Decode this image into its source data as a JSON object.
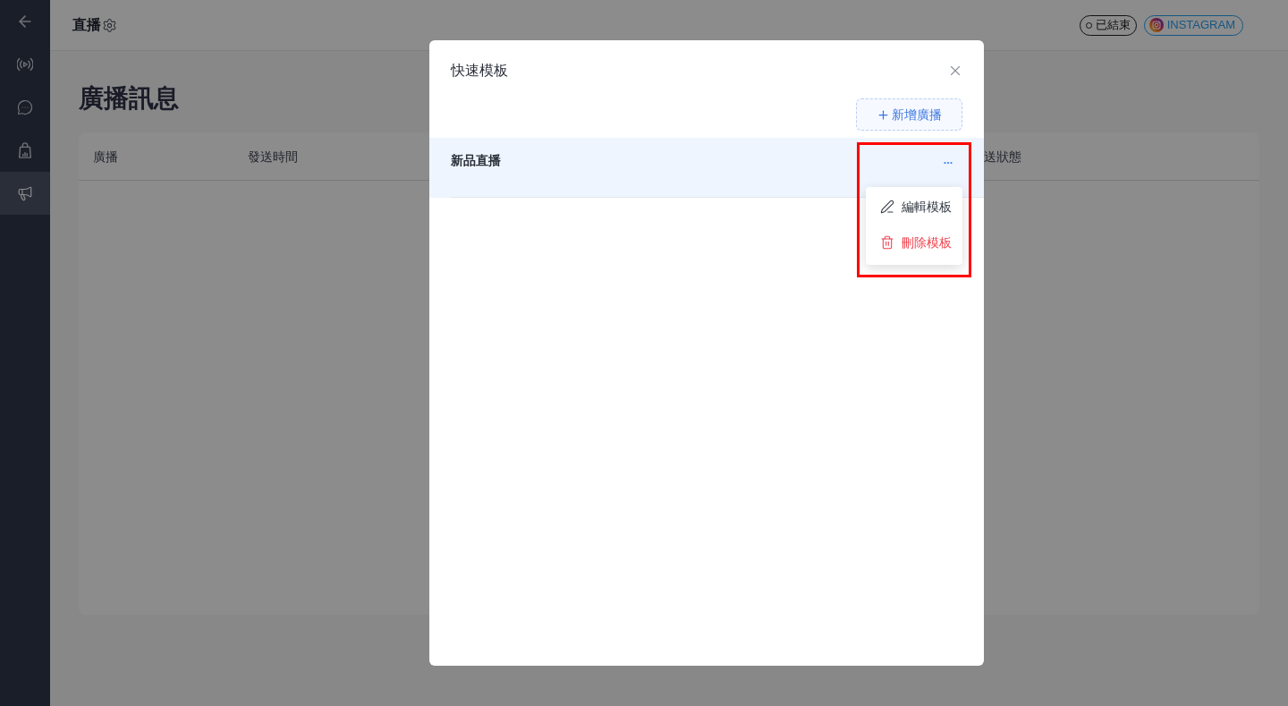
{
  "sidebar": {
    "items": [
      {
        "kind": "back",
        "selected": false
      },
      {
        "kind": "live",
        "selected": false
      },
      {
        "kind": "chat",
        "selected": false
      },
      {
        "kind": "shop",
        "selected": false
      },
      {
        "kind": "broadcast",
        "selected": true
      }
    ]
  },
  "header": {
    "title": "直播",
    "status_badge": "已結束",
    "platform_badge": "INSTAGRAM"
  },
  "page": {
    "title": "廣播訊息",
    "table": {
      "columns": [
        "廣播",
        "發送時間",
        "送狀態"
      ]
    }
  },
  "modal": {
    "title": "快速模板",
    "add_button": "新增廣播",
    "templates": [
      {
        "name": "新品直播",
        "selected": true,
        "expanded": true,
        "menu": [
          {
            "kind": "edit",
            "label": "編輯模板"
          },
          {
            "kind": "delete",
            "label": "刪除模板"
          }
        ]
      }
    ]
  },
  "annotation": {
    "kind": "frame"
  }
}
